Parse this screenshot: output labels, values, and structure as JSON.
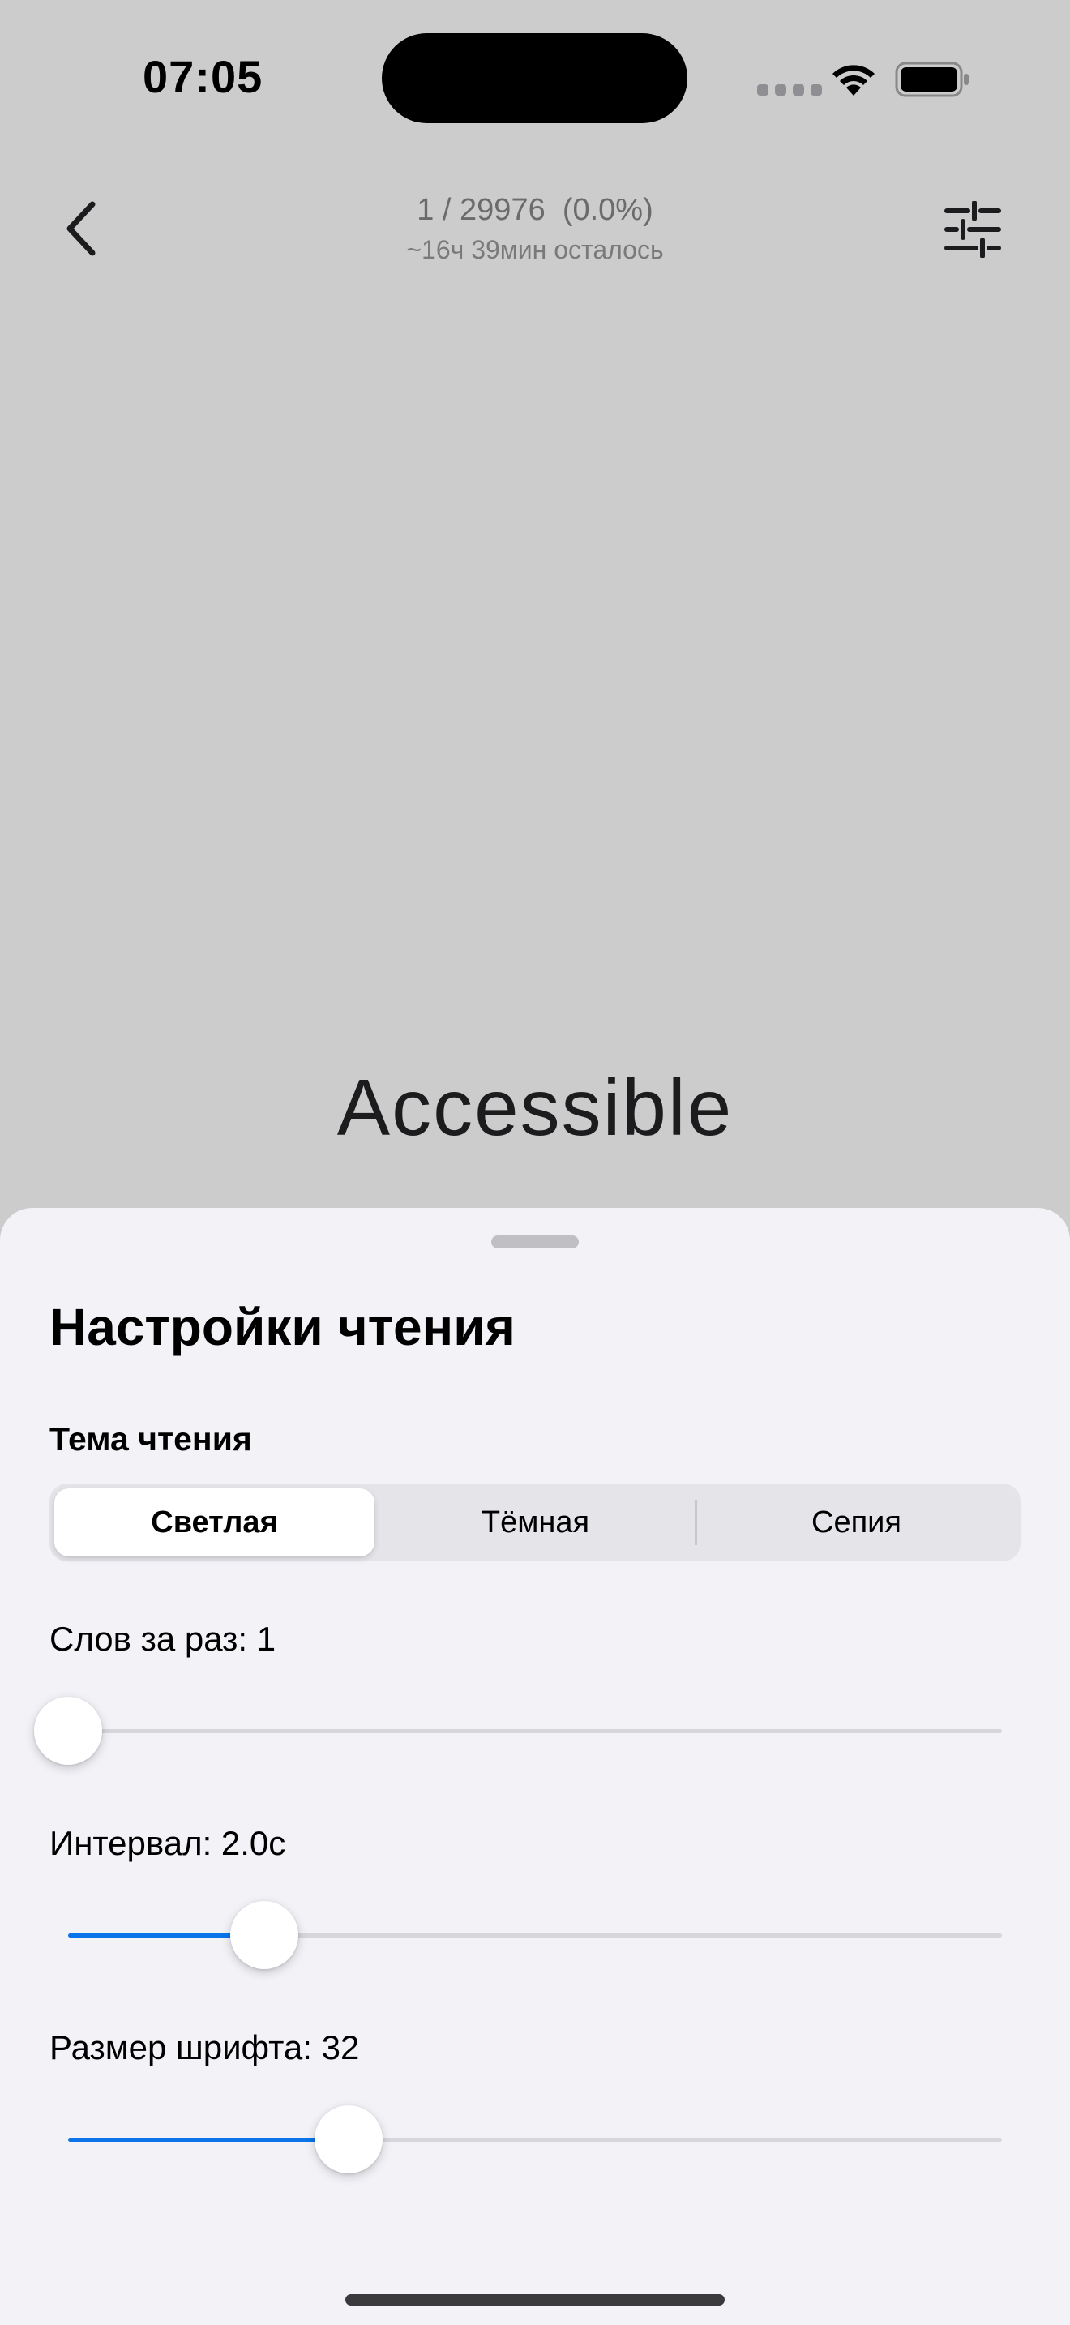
{
  "status_bar": {
    "time": "07:05",
    "icons": [
      "cellular-signal-icon",
      "wifi-icon",
      "battery-icon"
    ]
  },
  "nav": {
    "back_icon": "chevron-left-icon",
    "settings_icon": "sliders-icon",
    "progress": "1 / 29976  (0.0%)",
    "remaining": "~16ч 39мин осталось"
  },
  "reader": {
    "word": "Accessible"
  },
  "sheet": {
    "title": "Настройки чтения",
    "theme_label": "Тема чтения",
    "themes": [
      {
        "label": "Светлая",
        "selected": true
      },
      {
        "label": "Тёмная",
        "selected": false
      },
      {
        "label": "Сепия",
        "selected": false
      }
    ],
    "sliders": [
      {
        "label": "Слов за раз: 1",
        "fraction": 0.0
      },
      {
        "label": "Интервал: 2.0с",
        "fraction": 0.21
      },
      {
        "label": "Размер шрифта: 32",
        "fraction": 0.3
      }
    ]
  },
  "colors": {
    "accent": "#0a74e8",
    "background": "#cccccc",
    "sheet": "#f2f2f7"
  }
}
